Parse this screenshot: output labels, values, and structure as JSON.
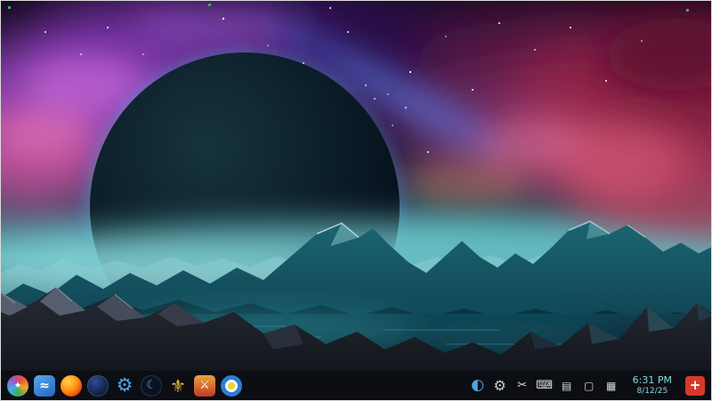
{
  "wallpaper": {
    "description": "Dark eclipsed planet over teal misty mountain lake, purple and crimson nebula sky, dark rocky foreground",
    "palette": {
      "sky_purple": "#7a34aa",
      "nebula_pink": "#d0549a",
      "nebula_crimson": "#9c2547",
      "mist_teal": "#57aab0",
      "mountain_teal": "#1c6572",
      "water_dark": "#0f4051",
      "rock_dark": "#14171d"
    }
  },
  "taskbar": {
    "background": "rgba(12,14,19,0.88)",
    "apps": [
      {
        "name": "app-launcher-icon",
        "glyph": "✦",
        "style": "background:conic-gradient(from 30deg,#e8503a,#f0a42a,#3fae52,#3daee9,#9b59d0,#e8503a);border-radius:50%;color:#fff;font-size:11px"
      },
      {
        "name": "file-manager-icon",
        "glyph": "≈",
        "style": "background:linear-gradient(145deg,#5aa8ec,#1d66c0);border-radius:6px;color:#fff;font-size:14px;font-weight:bold"
      },
      {
        "name": "firefox-icon",
        "glyph": "",
        "style": "background:radial-gradient(circle at 35% 30%,#ffd54a,#ff9216 45%,#e8420a 78%,#c0206a);border-radius:50%"
      },
      {
        "name": "dark-blue-app-icon",
        "glyph": "",
        "style": "background:radial-gradient(circle at 38% 32%,#2c4f92,#0f1b38 70%);border-radius:50%;box-shadow:inset 0 0 0 1px rgba(90,140,220,.4)"
      },
      {
        "name": "settings-gear-icon",
        "glyph": "⚙",
        "style": "background:transparent;color:#4aa3e8;font-size:21px"
      },
      {
        "name": "crescent-moon-app-icon",
        "glyph": "☾",
        "style": "background:#0c1220;border-radius:50%;color:#5ab0e8;font-size:13px;box-shadow:inset 0 0 0 1px rgba(70,120,200,.35)"
      },
      {
        "name": "gold-emblem-game-icon",
        "glyph": "⚜",
        "style": "background:transparent;color:#e6b63c;font-size:20px"
      },
      {
        "name": "warrior-game-icon",
        "glyph": "⚔",
        "style": "background:linear-gradient(180deg,#e8a43a,#c23b28);border-radius:5px;color:#fff;font-size:13px"
      },
      {
        "name": "target-ring-app-icon",
        "glyph": "",
        "style": "background:radial-gradient(circle,#f2cf3a 0 4px,#f8f8f8 4px 7px,#2d7dd2 7px);border-radius:50%"
      }
    ],
    "tray": [
      {
        "name": "night-color-icon",
        "glyph": "◐",
        "style": "color:#4fa8e0;font-size:17px"
      },
      {
        "name": "tray-settings-gear-icon",
        "glyph": "⚙",
        "style": "color:#c7ccd3;font-size:16px"
      },
      {
        "name": "clipboard-scissors-icon",
        "glyph": "✂",
        "style": "color:#dde1e6;font-size:13px"
      },
      {
        "name": "keyboard-layout-icon",
        "glyph": "⌨",
        "style": "color:#dde1e6;font-size:13px"
      },
      {
        "name": "printer-icon",
        "glyph": "▤",
        "style": "color:#d4d8de;font-size:12px"
      },
      {
        "name": "display-icon",
        "glyph": "▢",
        "style": "color:#d4d8de;font-size:12px"
      },
      {
        "name": "package-icon",
        "glyph": "▦",
        "style": "color:#d4d8de;font-size:12px"
      }
    ],
    "clock": {
      "time": "6:31 PM",
      "date": "8/12/25",
      "color": "#86d8dc"
    },
    "corner_icon": {
      "name": "red-tray-icon",
      "glyph": "+",
      "style": "background:#d6392c"
    }
  }
}
